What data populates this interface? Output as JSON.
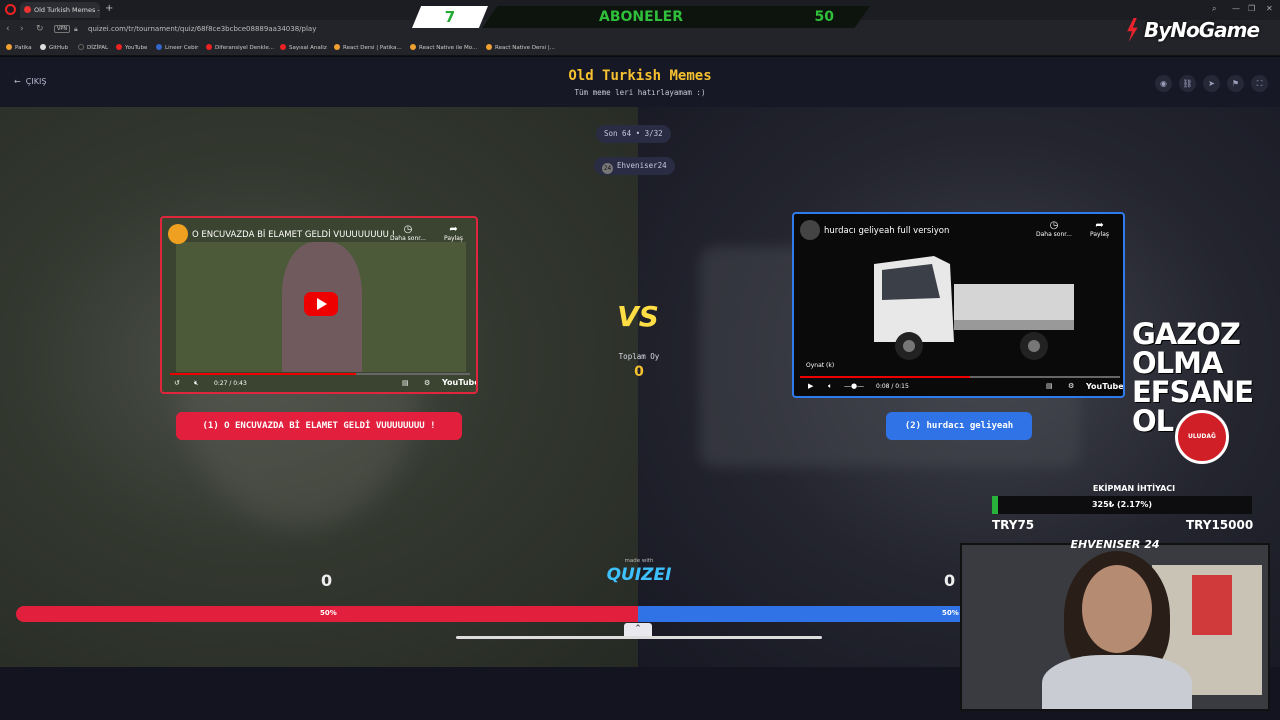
{
  "browser": {
    "tab_title": "Old Turkish Memes - Tier",
    "url": "quizei.com/tr/tournament/quiz/68f8ce3bcbce08889aa34038/play",
    "vpn_label": "VPN",
    "bookmarks": [
      "Patika",
      "GitHub",
      "DİZİPAL",
      "YouTube",
      "Lineer Cebir",
      "Diferansiyel Denkle...",
      "Sayısal Analiz",
      "React Dersi | Patika...",
      "React Native ile Mo...",
      "React Native Dersi |..."
    ]
  },
  "overlay": {
    "subs_current": "7",
    "subs_label": "ABONELER",
    "subs_goal": "50",
    "brand": "ByNoGame",
    "promo_lines": [
      "GAZOZ",
      "OLMA",
      "EFSANE",
      "OL"
    ],
    "badge_text": "ULUDAĞ",
    "equip_label": "EKİPMAN İHTİYACI",
    "equip_progress_text": "325₺ (2.17%)",
    "equip_fraction": 0.0217,
    "equip_min": "TRY75",
    "equip_max": "TRY15000",
    "cam_label": "EHVENISER 24"
  },
  "app": {
    "back_label": "ÇIKIŞ",
    "title": "Old Turkish Memes",
    "subtitle": "Tüm meme leri hatırlayamam :)",
    "round_pill": "Son 64 • 3/32",
    "user_pill": "Ehveniser24",
    "vs": "VS",
    "total_label": "Toplam Oy",
    "total_value": "0",
    "made_with": "made with",
    "quizei_logo": "QUIZEI",
    "left": {
      "video_title": "O ENCUVAZDA Bİ ELAMET GELDİ VUUUUUUUU !",
      "time": "0:27 / 0:43",
      "progress": 0.62,
      "choice_label": "(1) O ENCUVAZDA Bİ ELAMET GELDİ VUUUUUUUU !",
      "score": "0",
      "percent": "50%"
    },
    "right": {
      "video_title": "hurdacı geliyeah full versiyon",
      "time": "0:08 / 0:15",
      "progress": 0.53,
      "tooltip": "Oynat (k)",
      "choice_label": "(2) hurdacı geliyeah",
      "score": "0",
      "percent": "50%"
    },
    "yt": {
      "later": "Daha sonr...",
      "share": "Paylaş",
      "logo": "YouTube"
    }
  }
}
